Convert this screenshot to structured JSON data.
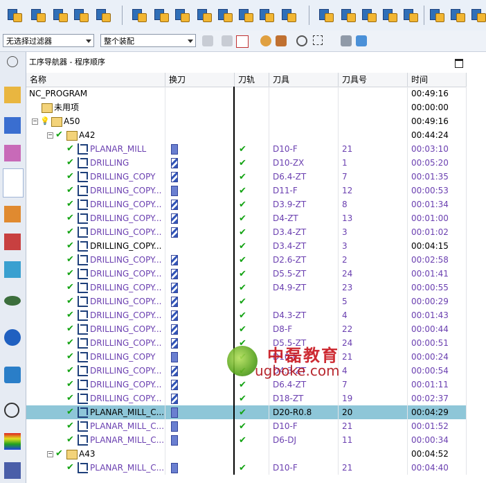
{
  "filter_combo": {
    "value": "无选择过滤器"
  },
  "assembly_combo": {
    "value": "整个装配"
  },
  "panel": {
    "title": "工序导航器 - 程序顺序"
  },
  "columns": [
    "名称",
    "换刀",
    "刀轨",
    "刀具",
    "刀具号",
    "时间"
  ],
  "rows": [
    {
      "name": "NC_PROGRAM",
      "time": "00:49:16"
    },
    {
      "name": "未用项",
      "time": "00:00:00"
    },
    {
      "name": "A50",
      "time": "00:49:16"
    },
    {
      "name": "A42",
      "time": "00:44:24"
    },
    {
      "name": "PLANAR_MILL",
      "cutter": "D10-F",
      "num": "21",
      "time": "00:03:10"
    },
    {
      "name": "DRILLING",
      "cutter": "D10-ZX",
      "num": "1",
      "time": "00:05:20"
    },
    {
      "name": "DRILLING_COPY",
      "cutter": "D6.4-ZT",
      "num": "7",
      "time": "00:01:35"
    },
    {
      "name": "DRILLING_COPY...",
      "cutter": "D11-F",
      "num": "12",
      "time": "00:00:53"
    },
    {
      "name": "DRILLING_COPY...",
      "cutter": "D3.9-ZT",
      "num": "8",
      "time": "00:01:34"
    },
    {
      "name": "DRILLING_COPY...",
      "cutter": "D4-ZT",
      "num": "13",
      "time": "00:01:00"
    },
    {
      "name": "DRILLING_COPY...",
      "cutter": "D3.4-ZT",
      "num": "3",
      "time": "00:01:02"
    },
    {
      "name": "DRILLING_COPY...",
      "cutter": "D3.4-ZT",
      "num": "3",
      "time": "00:04:15"
    },
    {
      "name": "DRILLING_COPY...",
      "cutter": "D2.6-ZT",
      "num": "2",
      "time": "00:02:58"
    },
    {
      "name": "DRILLING_COPY...",
      "cutter": "D5.5-ZT",
      "num": "24",
      "time": "00:01:41"
    },
    {
      "name": "DRILLING_COPY...",
      "cutter": "D4.9-ZT",
      "num": "23",
      "time": "00:00:55"
    },
    {
      "name": "DRILLING_COPY...",
      "cutter": "",
      "num": "5",
      "time": "00:00:29"
    },
    {
      "name": "DRILLING_COPY...",
      "cutter": "D4.3-ZT",
      "num": "4",
      "time": "00:01:43"
    },
    {
      "name": "DRILLING_COPY...",
      "cutter": "D8-F",
      "num": "22",
      "time": "00:00:44"
    },
    {
      "name": "DRILLING_COPY...",
      "cutter": "D5.5-ZT",
      "num": "24",
      "time": "00:00:51"
    },
    {
      "name": "DRILLING_COPY",
      "cutter": "D10-F",
      "num": "21",
      "time": "00:00:24"
    },
    {
      "name": "DRILLING_COPY...",
      "cutter": "D4.3-ZT",
      "num": "4",
      "time": "00:00:54"
    },
    {
      "name": "DRILLING_COPY...",
      "cutter": "D6.4-ZT",
      "num": "7",
      "time": "00:01:11"
    },
    {
      "name": "DRILLING_COPY...",
      "cutter": "D18-ZT",
      "num": "19",
      "time": "00:02:37"
    },
    {
      "name": "PLANAR_MILL_C...",
      "cutter": "D20-R0.8",
      "num": "20",
      "time": "00:04:29"
    },
    {
      "name": "PLANAR_MILL_C...",
      "cutter": "D10-F",
      "num": "21",
      "time": "00:01:52"
    },
    {
      "name": "PLANAR_MILL_C...",
      "cutter": "D6-DJ",
      "num": "11",
      "time": "00:00:34"
    },
    {
      "name": "A43",
      "time": "00:04:52"
    },
    {
      "name": "PLANAR_MILL_C...",
      "cutter": "D10-F",
      "num": "21",
      "time": "00:04:40"
    }
  ],
  "watermark": {
    "cn": "中磊教育",
    "en": "ugboke.com"
  }
}
